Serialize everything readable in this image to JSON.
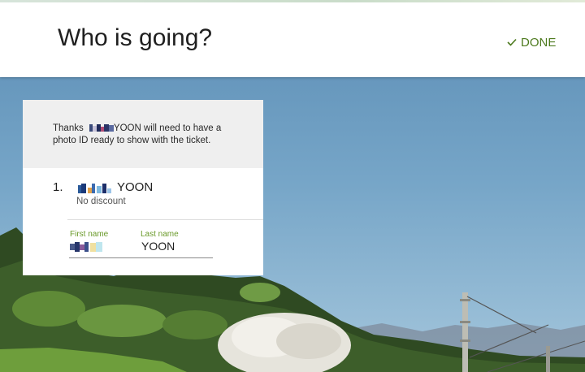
{
  "header": {
    "title": "Who is going?",
    "done_label": "DONE",
    "accent_color": "#4d7a1e"
  },
  "notice": {
    "prefix": "Thanks",
    "name_suffix": "YOON",
    "line1_rest": "will need to have a",
    "line2": "photo ID ready to show with the ticket."
  },
  "passenger": {
    "number": "1.",
    "last_name_display": "YOON",
    "discount": "No discount",
    "first_name_label": "First name",
    "last_name_label": "Last name",
    "last_name_value": "YOON"
  },
  "icons": {
    "done": "checkmark-icon"
  }
}
